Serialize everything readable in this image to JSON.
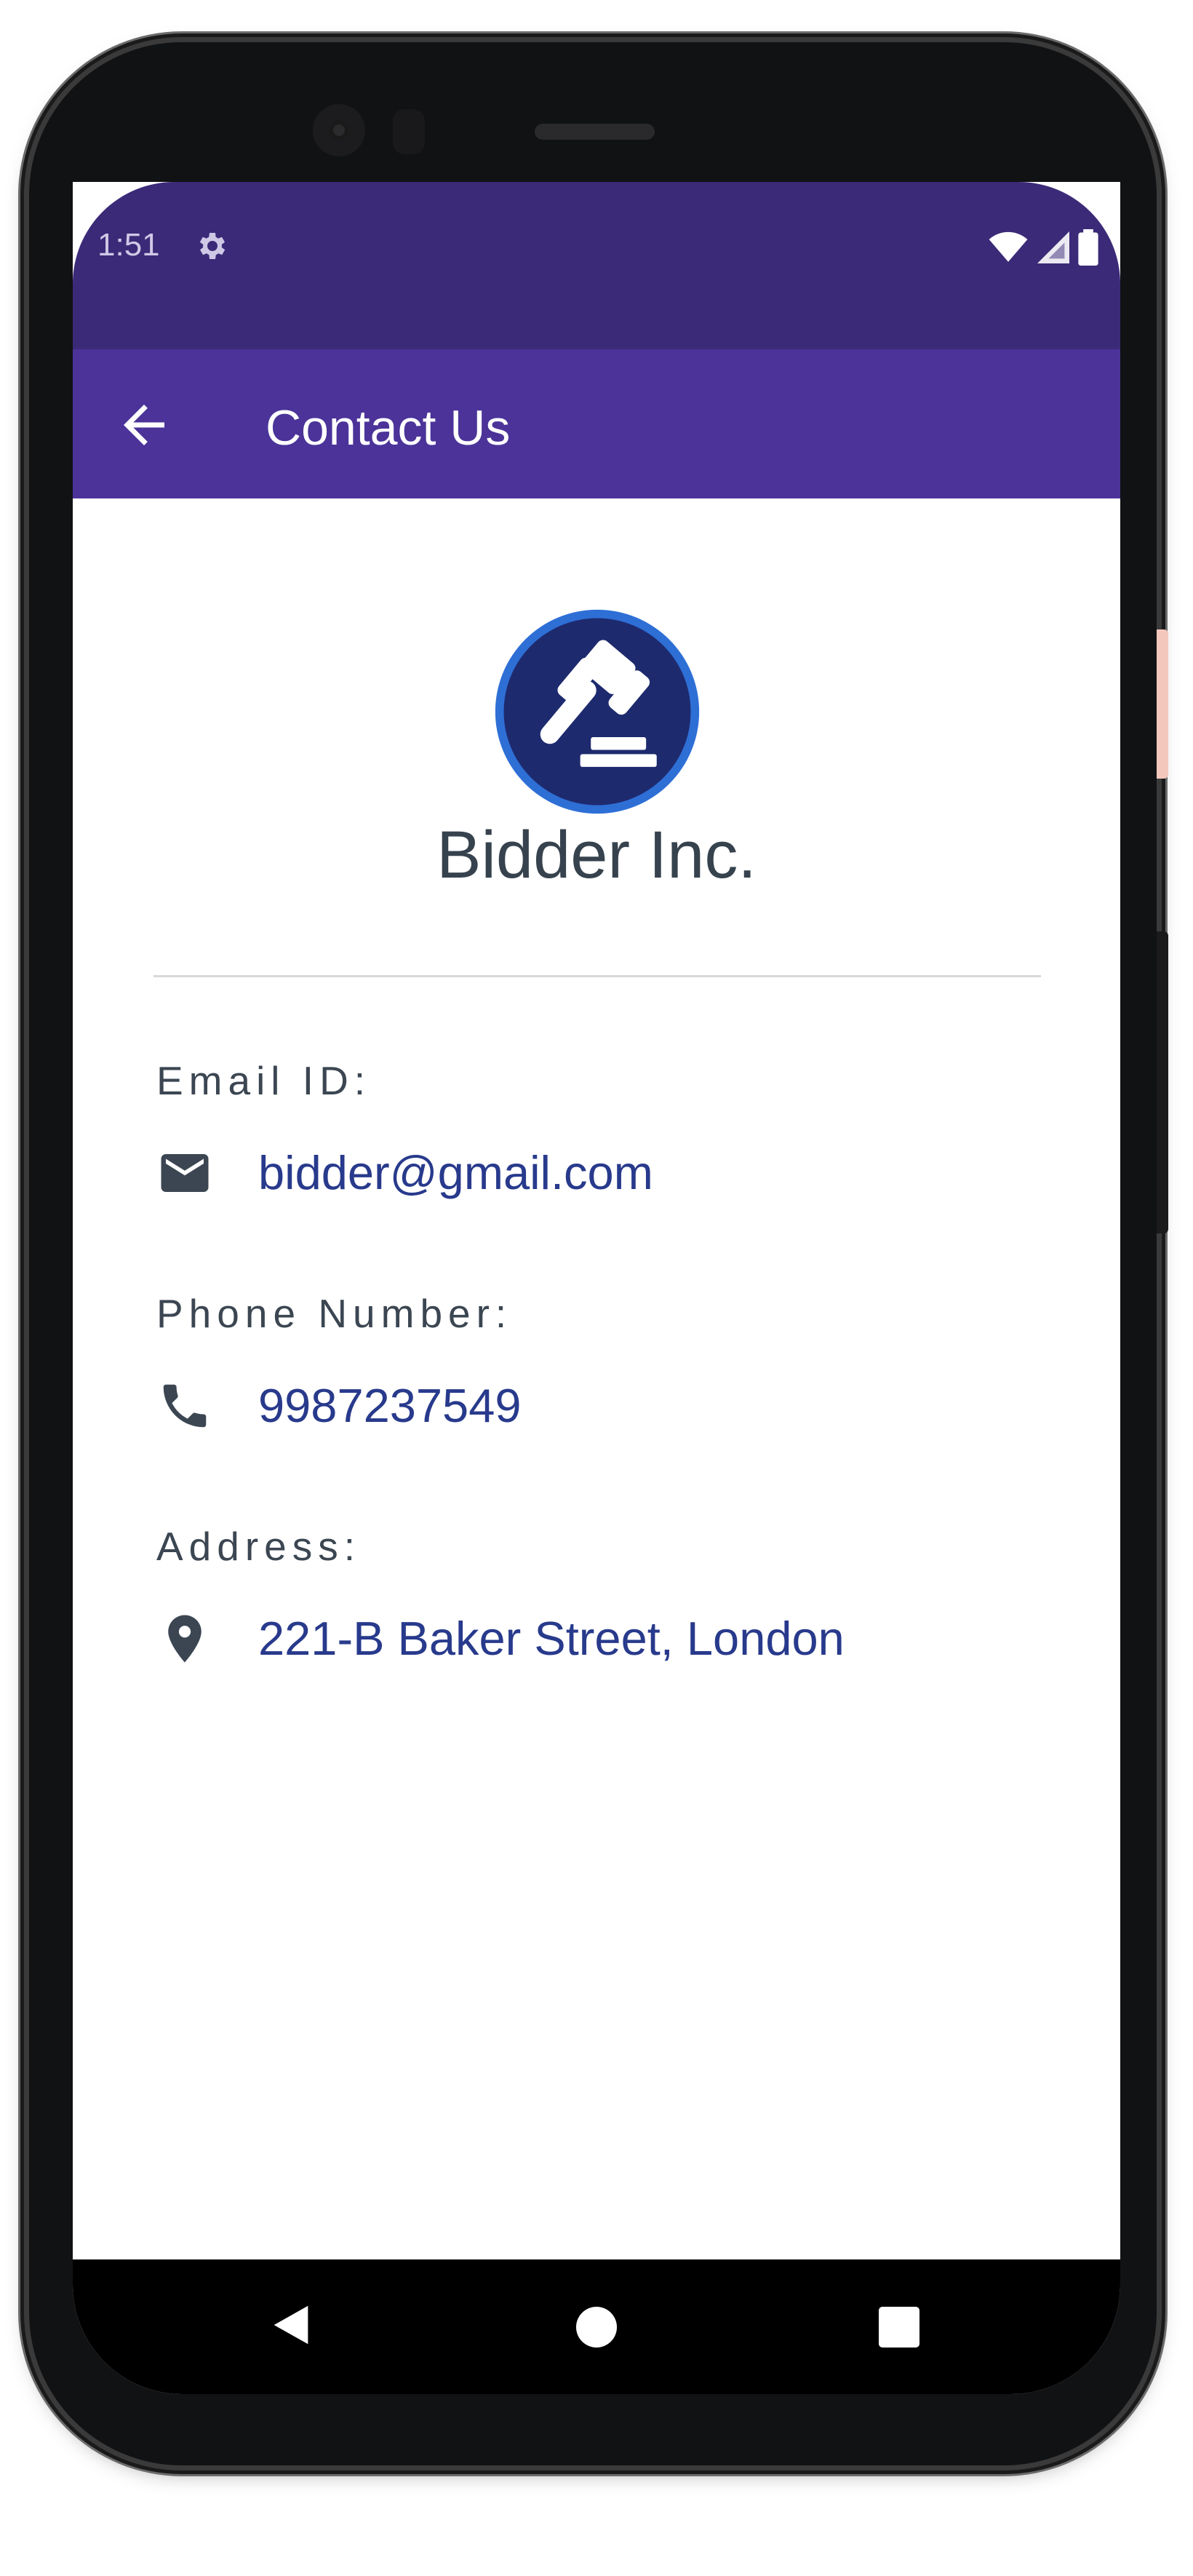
{
  "status_bar": {
    "time": "1:51",
    "settings_icon": "gear-icon",
    "wifi_icon": "wifi-icon",
    "signal_icon": "signal-icon",
    "battery_icon": "battery-icon"
  },
  "app_bar": {
    "back_icon": "arrow-left-icon",
    "title": "Contact Us"
  },
  "company": {
    "logo_icon": "gavel-icon",
    "name": "Bidder Inc."
  },
  "contacts": {
    "email": {
      "label": "Email ID:",
      "icon": "mail-icon",
      "value": "bidder@gmail.com"
    },
    "phone": {
      "label": "Phone Number:",
      "icon": "phone-icon",
      "value": "9987237549"
    },
    "address": {
      "label": "Address:",
      "icon": "location-pin-icon",
      "value": "221-B Baker Street, London"
    }
  },
  "nav_bar": {
    "back_icon": "nav-back-icon",
    "home_icon": "nav-home-icon",
    "recents_icon": "nav-recents-icon"
  },
  "colors": {
    "status_bar_bg": "#3b2a78",
    "app_bar_bg": "#4b3399",
    "value_text": "#283a8c",
    "label_text": "#3b4652",
    "logo_bg": "#1e2a6e",
    "logo_ring": "#2e6fd6"
  }
}
